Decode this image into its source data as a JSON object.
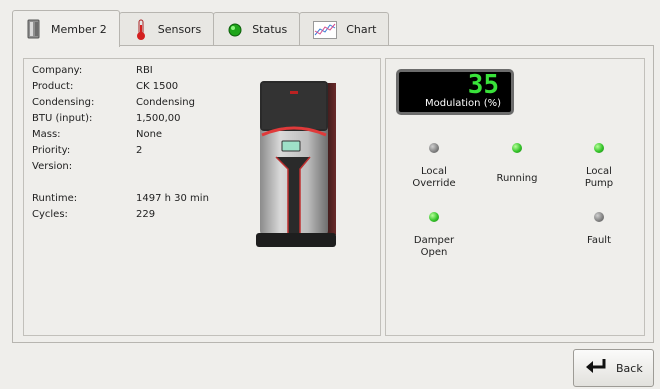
{
  "tabs": [
    {
      "label": "Member 2",
      "icon": "boiler-icon",
      "active": true
    },
    {
      "label": "Sensors",
      "icon": "thermometer-icon",
      "active": false
    },
    {
      "label": "Status",
      "icon": "green-status-dot-icon",
      "active": false
    },
    {
      "label": "Chart",
      "icon": "chart-icon",
      "active": false
    }
  ],
  "info": {
    "company_label": "Company:",
    "company_value": "RBI",
    "product_label": "Product:",
    "product_value": "CK 1500",
    "condensing_label": "Condensing:",
    "condensing_value": "Condensing",
    "btu_label": "BTU (input):",
    "btu_value": "1,500,00",
    "mass_label": "Mass:",
    "mass_value": "None",
    "priority_label": "Priority:",
    "priority_value": "2",
    "version_label": "Version:",
    "version_value": "",
    "runtime_label": "Runtime:",
    "runtime_value": "1497 h 30 min",
    "cycles_label": "Cycles:",
    "cycles_value": "229"
  },
  "modulation": {
    "value": "35",
    "label": "Modulation (%)"
  },
  "status": [
    {
      "label": "Local\nOverride",
      "on": false
    },
    {
      "label": "Running",
      "on": true
    },
    {
      "label": "Local\nPump",
      "on": true
    },
    {
      "label": "Damper\nOpen",
      "on": true
    },
    {
      "label": "Fault",
      "on": false
    }
  ],
  "status_labels": {
    "local_override": "Local Override",
    "running": "Running",
    "local_pump": "Local Pump",
    "damper_open": "Damper Open",
    "fault": "Fault"
  },
  "colors": {
    "led_on": "#35c42a",
    "led_off": "#7e7e7e",
    "display_digits": "#39e23a"
  },
  "back_button": {
    "label": "Back",
    "icon": "return-arrow-icon"
  }
}
